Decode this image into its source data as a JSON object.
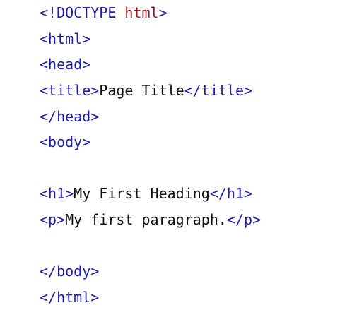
{
  "code": {
    "line1_tag": "<!DOCTYPE",
    "line1_kw": " html",
    "line1_end": ">",
    "line2": "<html>",
    "line3": "<head>",
    "line4_open": "<title>",
    "line4_text": "Page Title",
    "line4_close": "</title>",
    "line5": "</head>",
    "line6": "<body>",
    "line8_open": "<h1>",
    "line8_text": "My First Heading",
    "line8_close": "</h1>",
    "line9_open": "<p>",
    "line9_text": "My first paragraph.",
    "line9_close": "</p>",
    "line11": "</body>",
    "line12": "</html>"
  },
  "colors": {
    "tag": "#1f1fb0",
    "keyword": "#a3161b",
    "text": "#111111",
    "background": "#ffffff"
  }
}
